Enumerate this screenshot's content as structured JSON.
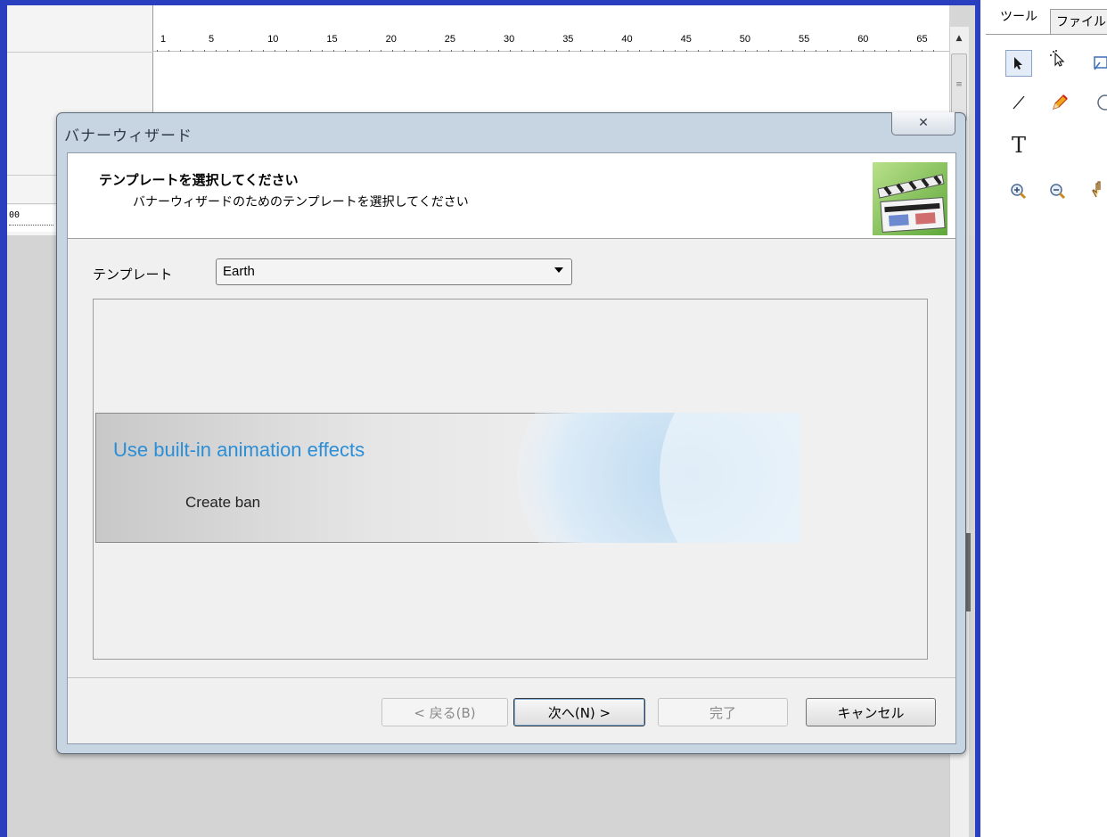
{
  "ruler": {
    "ticks": [
      "1",
      "5",
      "10",
      "15",
      "20",
      "25",
      "30",
      "35",
      "40",
      "45",
      "50",
      "55",
      "60",
      "65"
    ],
    "left_number": "00"
  },
  "right_panel": {
    "tabs": [
      "ツール",
      "ファイル"
    ],
    "tools": [
      "select-arrow-icon",
      "direct-select-icon",
      "frame-icon",
      "line-icon",
      "pencil-icon",
      "ellipse-icon",
      "text-icon",
      "zoom-in-icon",
      "zoom-out-icon",
      "hand-icon"
    ],
    "text_tool_label": "T"
  },
  "dialog": {
    "title": "バナーウィザード",
    "close_glyph": "✕",
    "header_title": "テンプレートを選択してください",
    "header_subtitle": "バナーウィザードのためのテンプレートを選択してください",
    "template_label": "テンプレート",
    "template_value": "Earth",
    "preview": {
      "headline": "Use built-in animation effects",
      "subline": "Create ban"
    },
    "buttons": {
      "back": "< 戻る(B)",
      "next": "次へ(N) >",
      "finish": "完了",
      "cancel": "キャンセル"
    }
  },
  "colors": {
    "frame_blue": "#2a3fbf",
    "headline_blue": "#2b8ed6"
  }
}
